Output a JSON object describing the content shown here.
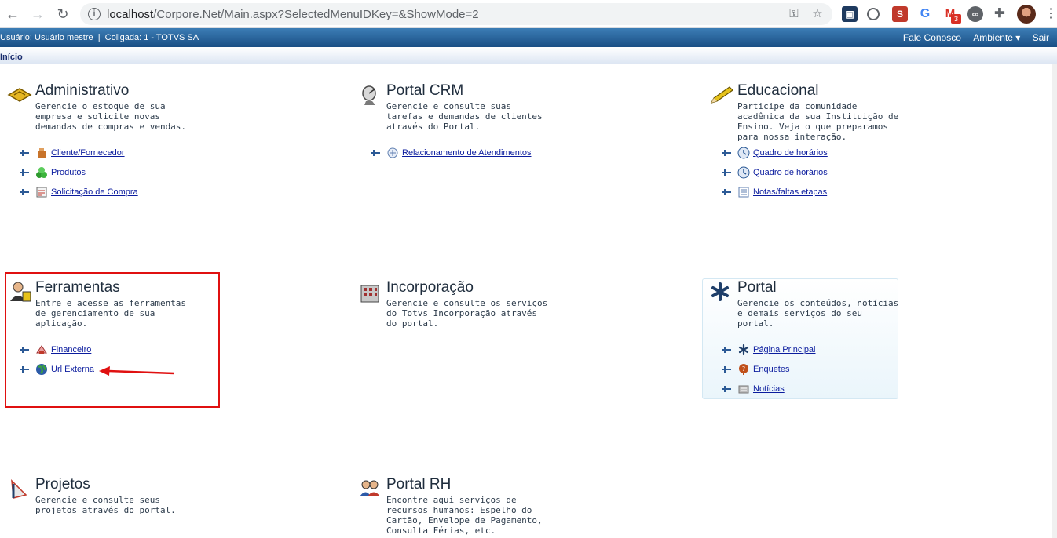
{
  "browser": {
    "url_host": "localhost",
    "url_path": "/Corpore.Net/Main.aspx?SelectedMenuIDKey=&ShowMode=2",
    "gmail_badge": "3"
  },
  "header": {
    "user_info": "Usuário: Usuário mestre  |  Coligada: 1 - TOTVS SA",
    "contact_link": "Fale Conosco",
    "environment_menu": "Ambiente ▾",
    "logout_link": "Sair"
  },
  "breadcrumb": "Início",
  "modules": {
    "administrativo": {
      "title": "Administrativo",
      "description": "Gerencie o estoque de sua empresa e solicite novas demandas de compras e vendas.",
      "links": [
        "Cliente/Fornecedor",
        "Produtos",
        "Solicitação de Compra"
      ]
    },
    "portal_crm": {
      "title": "Portal CRM",
      "description": "Gerencie e consulte suas tarefas e demandas de clientes através do Portal.",
      "links": [
        "Relacionamento de Atendimentos"
      ]
    },
    "educacional": {
      "title": "Educacional",
      "description": "Participe da comunidade acadêmica da sua Instituição de Ensino. Veja o que preparamos para nossa interação.",
      "links": [
        "Quadro de horários",
        "Quadro de horários",
        "Notas/faltas etapas"
      ]
    },
    "ferramentas": {
      "title": "Ferramentas",
      "description": "Entre e acesse as ferramentas de gerenciamento de sua aplicação.",
      "links": [
        "Financeiro",
        "Url Externa"
      ]
    },
    "incorporacao": {
      "title": "Incorporação",
      "description": "Gerencie e consulte os serviços do Totvs Incorporação através do portal."
    },
    "portal": {
      "title": "Portal",
      "description": "Gerencie os conteúdos, notícias e demais serviços do seu portal.",
      "links": [
        "Página Principal",
        "Enquetes",
        "Notícias"
      ]
    },
    "projetos": {
      "title": "Projetos",
      "description": "Gerencie e consulte seus projetos através do portal."
    },
    "portal_rh": {
      "title": "Portal RH",
      "description": "Encontre aqui serviços de recursos humanos: Espelho do Cartão, Envelope de Pagamento, Consulta Férias, etc."
    }
  },
  "colors": {
    "header_blue": "#1a4f85",
    "link_blue": "#0b1c9e",
    "highlight_red": "#e01010"
  }
}
